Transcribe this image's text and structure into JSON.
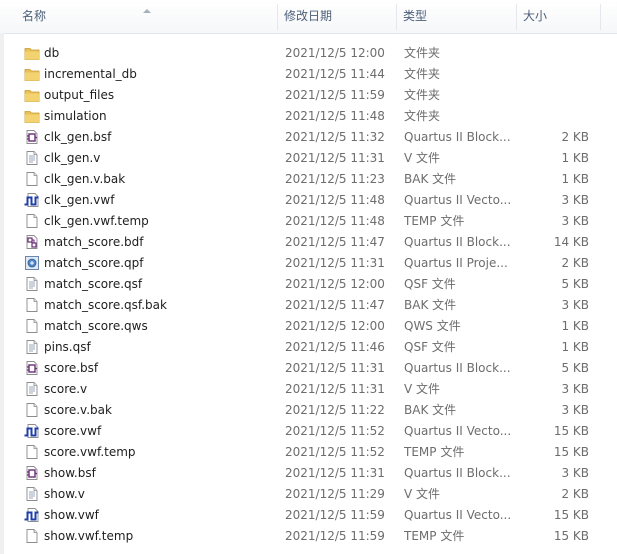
{
  "columns": {
    "name": "名称",
    "date": "修改日期",
    "type": "类型",
    "size": "大小"
  },
  "files": [
    {
      "name": "db",
      "date": "2021/12/5 12:00",
      "type": "文件夹",
      "size": "",
      "icon": "folder-icon"
    },
    {
      "name": "incremental_db",
      "date": "2021/12/5 11:44",
      "type": "文件夹",
      "size": "",
      "icon": "folder-icon"
    },
    {
      "name": "output_files",
      "date": "2021/12/5 11:59",
      "type": "文件夹",
      "size": "",
      "icon": "folder-icon"
    },
    {
      "name": "simulation",
      "date": "2021/12/5 11:48",
      "type": "文件夹",
      "size": "",
      "icon": "folder-icon"
    },
    {
      "name": "clk_gen.bsf",
      "date": "2021/12/5 11:32",
      "type": "Quartus II Block...",
      "size": "2 KB",
      "icon": "block-symbol-file-icon"
    },
    {
      "name": "clk_gen.v",
      "date": "2021/12/5 11:31",
      "type": "V 文件",
      "size": "1 KB",
      "icon": "text-file-icon"
    },
    {
      "name": "clk_gen.v.bak",
      "date": "2021/12/5 11:23",
      "type": "BAK 文件",
      "size": "1 KB",
      "icon": "blank-file-icon"
    },
    {
      "name": "clk_gen.vwf",
      "date": "2021/12/5 11:48",
      "type": "Quartus II Vecto...",
      "size": "3 KB",
      "icon": "waveform-file-icon"
    },
    {
      "name": "clk_gen.vwf.temp",
      "date": "2021/12/5 11:48",
      "type": "TEMP 文件",
      "size": "3 KB",
      "icon": "blank-file-icon"
    },
    {
      "name": "match_score.bdf",
      "date": "2021/12/5 11:47",
      "type": "Quartus II Block...",
      "size": "14 KB",
      "icon": "block-diagram-file-icon"
    },
    {
      "name": "match_score.qpf",
      "date": "2021/12/5 11:31",
      "type": "Quartus II Proje...",
      "size": "2 KB",
      "icon": "project-file-icon"
    },
    {
      "name": "match_score.qsf",
      "date": "2021/12/5 12:00",
      "type": "QSF 文件",
      "size": "5 KB",
      "icon": "text-file-icon"
    },
    {
      "name": "match_score.qsf.bak",
      "date": "2021/12/5 11:47",
      "type": "BAK 文件",
      "size": "3 KB",
      "icon": "blank-file-icon"
    },
    {
      "name": "match_score.qws",
      "date": "2021/12/5 12:00",
      "type": "QWS 文件",
      "size": "1 KB",
      "icon": "blank-file-icon"
    },
    {
      "name": "pins.qsf",
      "date": "2021/12/5 11:46",
      "type": "QSF 文件",
      "size": "1 KB",
      "icon": "text-file-icon"
    },
    {
      "name": "score.bsf",
      "date": "2021/12/5 11:31",
      "type": "Quartus II Block...",
      "size": "5 KB",
      "icon": "block-symbol-file-icon"
    },
    {
      "name": "score.v",
      "date": "2021/12/5 11:31",
      "type": "V 文件",
      "size": "3 KB",
      "icon": "text-file-icon"
    },
    {
      "name": "score.v.bak",
      "date": "2021/12/5 11:22",
      "type": "BAK 文件",
      "size": "3 KB",
      "icon": "blank-file-icon"
    },
    {
      "name": "score.vwf",
      "date": "2021/12/5 11:52",
      "type": "Quartus II Vecto...",
      "size": "15 KB",
      "icon": "waveform-file-icon"
    },
    {
      "name": "score.vwf.temp",
      "date": "2021/12/5 11:52",
      "type": "TEMP 文件",
      "size": "15 KB",
      "icon": "blank-file-icon"
    },
    {
      "name": "show.bsf",
      "date": "2021/12/5 11:31",
      "type": "Quartus II Block...",
      "size": "3 KB",
      "icon": "block-symbol-file-icon"
    },
    {
      "name": "show.v",
      "date": "2021/12/5 11:29",
      "type": "V 文件",
      "size": "2 KB",
      "icon": "text-file-icon"
    },
    {
      "name": "show.vwf",
      "date": "2021/12/5 11:59",
      "type": "Quartus II Vecto...",
      "size": "15 KB",
      "icon": "waveform-file-icon"
    },
    {
      "name": "show.vwf.temp",
      "date": "2021/12/5 11:59",
      "type": "TEMP 文件",
      "size": "15 KB",
      "icon": "blank-file-icon"
    }
  ],
  "colors": {
    "header_text": "#4c607a",
    "folder": "#e9c15a",
    "secondary_text": "#6d6d6d",
    "waveform": "#1f3fa8",
    "block_symbol": "#6b2a7a"
  }
}
